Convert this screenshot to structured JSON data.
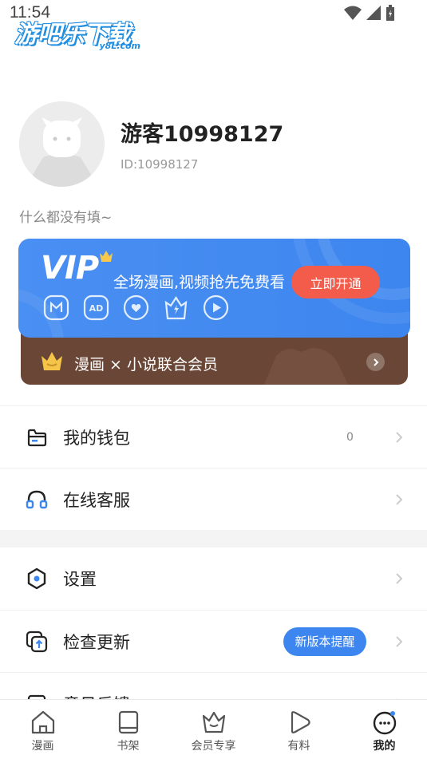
{
  "status_bar": {
    "time": "11:54"
  },
  "watermark": {
    "title": "游吧乐下载",
    "sub": "y8L.com"
  },
  "profile": {
    "username": "游客10998127",
    "user_id": "ID:10998127",
    "bio": "什么都没有填~"
  },
  "vip": {
    "logo": "VIP",
    "slogan": "全场漫画,视频抢先免费看",
    "button": "立即开通",
    "perk_icons": [
      "manga-icon",
      "ad-icon",
      "heart-icon",
      "bolt-icon",
      "play-icon"
    ],
    "novel_label": "漫画 × 小说联合会员"
  },
  "menu": {
    "wallet": {
      "label": "我的钱包",
      "count": "0"
    },
    "service": {
      "label": "在线客服"
    },
    "settings": {
      "label": "设置"
    },
    "update": {
      "label": "检查更新",
      "badge": "新版本提醒"
    },
    "feedback": {
      "label": "意见反馈"
    }
  },
  "tabs": [
    {
      "label": "漫画",
      "icon": "house-icon"
    },
    {
      "label": "书架",
      "icon": "book-icon"
    },
    {
      "label": "会员专享",
      "icon": "crown-icon"
    },
    {
      "label": "有料",
      "icon": "play-icon"
    },
    {
      "label": "我的",
      "icon": "face-icon",
      "active": true
    }
  ],
  "colors": {
    "accent": "#3d86ef",
    "vip_button": "#f35b4b",
    "novel_bar": "#6a4636"
  }
}
